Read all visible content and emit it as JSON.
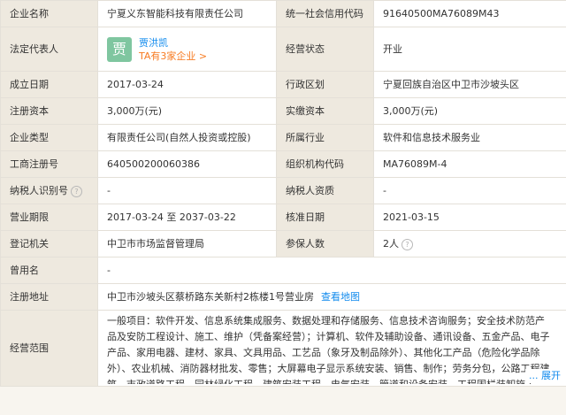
{
  "rows": {
    "company_name": {
      "label": "企业名称",
      "value": "宁夏义东智能科技有限责任公司"
    },
    "credit_code": {
      "label": "统一社会信用代码",
      "value": "91640500MA76089M43"
    },
    "legal_rep": {
      "label": "法定代表人",
      "avatar_char": "贾",
      "name": "贾洪凯",
      "link": "TA有3家企业 >"
    },
    "status": {
      "label": "经营状态",
      "value": "开业"
    },
    "founded": {
      "label": "成立日期",
      "value": "2017-03-24"
    },
    "region": {
      "label": "行政区划",
      "value": "宁夏回族自治区中卫市沙坡头区"
    },
    "reg_capital": {
      "label": "注册资本",
      "value": "3,000万(元)"
    },
    "paid_capital": {
      "label": "实缴资本",
      "value": "3,000万(元)"
    },
    "type": {
      "label": "企业类型",
      "value": "有限责任公司(自然人投资或控股)"
    },
    "industry": {
      "label": "所属行业",
      "value": "软件和信息技术服务业"
    },
    "reg_no": {
      "label": "工商注册号",
      "value": "640500200060386"
    },
    "org_code": {
      "label": "组织机构代码",
      "value": "MA76089M-4"
    },
    "taxpayer_id": {
      "label": "纳税人识别号",
      "help_icon": "?",
      "value": "-"
    },
    "taxpayer_qual": {
      "label": "纳税人资质",
      "value": "-"
    },
    "term": {
      "label": "营业期限",
      "value": "2017-03-24 至 2037-03-22"
    },
    "approval": {
      "label": "核准日期",
      "value": "2021-03-15"
    },
    "authority": {
      "label": "登记机关",
      "value": "中卫市市场监督管理局"
    },
    "insured": {
      "label": "参保人数",
      "value": "2人",
      "help_icon": "?"
    },
    "former_name": {
      "label": "曾用名",
      "value": "-"
    },
    "address": {
      "label": "注册地址",
      "value": "中卫市沙坡头区蔡桥路东关新村2栋楼1号营业房",
      "map_link": "查看地图"
    },
    "scope": {
      "label": "经营范围",
      "value": "一般项目：软件开发、信息系统集成服务、数据处理和存储服务、信息技术咨询服务；安全技术防范产品及安防工程设计、施工、维护（凭备案经营）；计算机、软件及辅助设备、通讯设备、五金产品、电子产品、家用电器、建材、家具、文具用品、工艺品（象牙及制品除外）、其他化工产品（危险化学品除外）、农业机械、消防器材批发、零售；大屏幕电子显示系统安装、销售、制作；劳务分包，公路工程建筑，市政道路工程，园林绿化工程，建筑安装工程，电气安装，管道和设备安装，工程围栏装卸施工，建筑物照明设备安装",
      "expand_label": "... 展开"
    }
  },
  "colors": {
    "label_bg": "#eee9df",
    "value_bg": "#ffffff",
    "link_blue": "#128bed",
    "link_orange": "#f77b22",
    "avatar_green": "#7fc6a0"
  }
}
